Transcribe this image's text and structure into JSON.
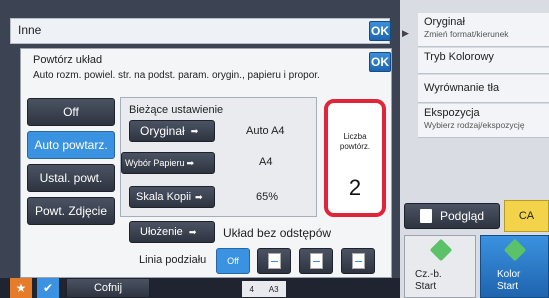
{
  "topbar": {
    "title": "Inne",
    "ok_label": "OK"
  },
  "right_menu": [
    {
      "title": "Oryginał",
      "sub": "Zmień format/kierunek"
    },
    {
      "title": "Tryb Kolorowy",
      "sub": ""
    },
    {
      "title": "Wyrównanie tła",
      "sub": ""
    },
    {
      "title": "Ekspozycja",
      "sub": "Wybierz rodzaj/ekspozycję"
    }
  ],
  "dialog": {
    "title": "Powtórz układ",
    "description": "Auto rozm. powiel. str. na podst. param. orygin., papieru i propor.",
    "ok_label": "OK"
  },
  "modes": [
    {
      "label": "Off",
      "selected": false
    },
    {
      "label": "Auto powtarz.",
      "selected": true
    },
    {
      "label": "Ustal. powt.",
      "selected": false
    },
    {
      "label": "Powt. Zdjęcie",
      "selected": false
    }
  ],
  "settings": {
    "heading": "Bieżące ustawienie",
    "original_label": "Oryginał",
    "original_value": "Auto A4",
    "paper_label": "Wybór Papieru",
    "paper_value": "A4",
    "scale_label": "Skala Kopii",
    "scale_value": "65%"
  },
  "count": {
    "label": "Liczba powtórz.",
    "value": "2"
  },
  "layout": {
    "label": "Ułożenie",
    "value": "Układ bez odstępów"
  },
  "division": {
    "label": "Linia podziału",
    "off_label": "Off"
  },
  "bottom": {
    "back_label": "Cofnij",
    "paper_count": "4",
    "paper_size": "A3"
  },
  "actions": {
    "preview_label": "Podgląd",
    "ca_label": "CA",
    "bw_label": "Cz.-b.",
    "bw_start": "Start",
    "color_label": "Kolor",
    "color_start": "Start"
  },
  "colors": {
    "accent": "#3a92e0",
    "highlight": "#e0243a",
    "ca": "#f2d34a"
  }
}
